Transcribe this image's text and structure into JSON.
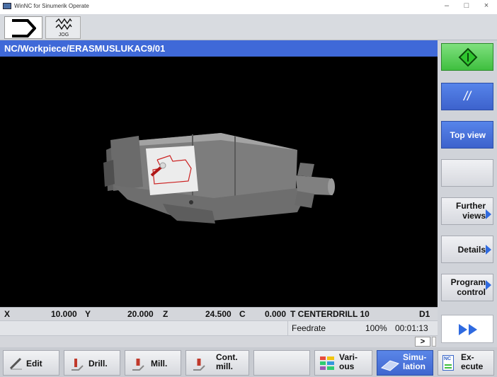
{
  "window": {
    "title": "WinNC for Sinumerik Operate",
    "minimize": "–",
    "maximize": "□",
    "close": "×"
  },
  "header": {
    "jog_label": "JOG"
  },
  "path": "NC/Workpiece/ERASMUSLUKAC9/01",
  "status": {
    "x_label": "X",
    "x_value": "10.000",
    "y_label": "Y",
    "y_value": "20.000",
    "z_label": "Z",
    "z_value": "24.500",
    "c_label": "C",
    "c_value": "0.000",
    "tool": "T CENTERDRILL 10",
    "d": "D1",
    "feedrate_label": "Feedrate",
    "feedrate_value": "100%",
    "time": "00:01:13",
    "more": ">"
  },
  "right_softkeys": {
    "parallel": "//",
    "top_view": "Top view",
    "further_views_1": "Further",
    "further_views_2": "views",
    "details": "Details",
    "program_control_1": "Program",
    "program_control_2": "control"
  },
  "bottom_softkeys": {
    "edit": "Edit",
    "drill": "Drill.",
    "mill": "Mill.",
    "cont_mill_1": "Cont.",
    "cont_mill_2": "mill.",
    "various_1": "Vari-",
    "various_2": "ous",
    "simulation_1": "Simu-",
    "simulation_2": "lation",
    "execute_icon_text": "NC",
    "execute_1": "Ex-",
    "execute_2": "ecute"
  },
  "colors": {
    "accent_blue": "#3f69d8",
    "start_green": "#3fbf3f",
    "viewport": "#000000"
  }
}
